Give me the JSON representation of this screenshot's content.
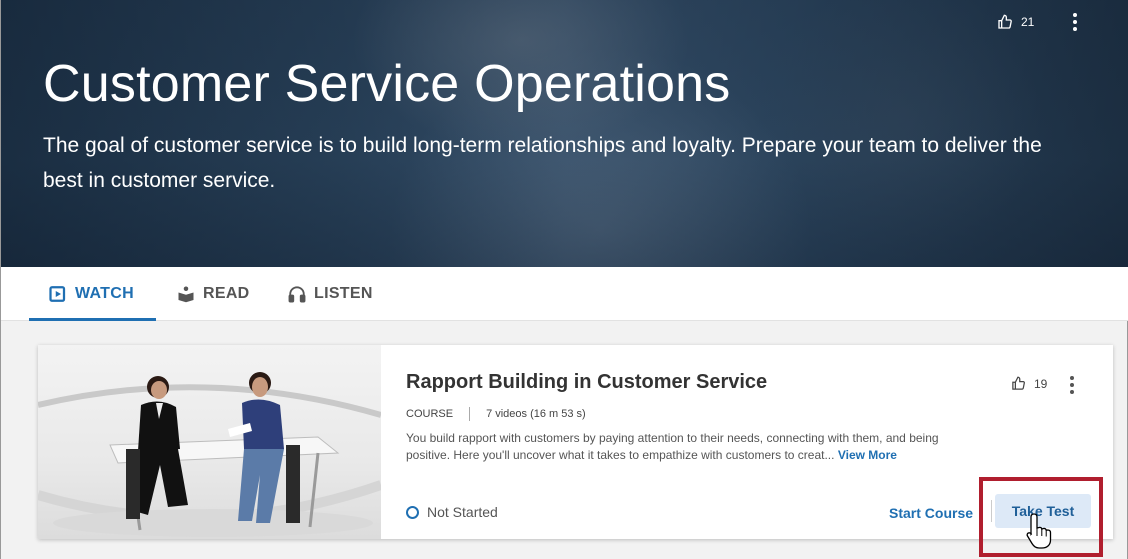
{
  "hero": {
    "title": "Customer Service Operations",
    "description": "The goal of customer service is to build long-term relationships and loyalty. Prepare your team to deliver the best in customer service.",
    "likes": "21",
    "like_icon": "thumbs-up-icon",
    "menu_icon": "more-vertical-icon"
  },
  "tabs": [
    {
      "label": "WATCH",
      "icon": "video-icon",
      "active": true
    },
    {
      "label": "READ",
      "icon": "book-reader-icon",
      "active": false
    },
    {
      "label": "LISTEN",
      "icon": "headphones-icon",
      "active": false
    }
  ],
  "card": {
    "title": "Rapport Building in Customer Service",
    "type": "COURSE",
    "videos": "7 videos (16 m 53 s)",
    "description": "You build rapport with customers by paying attention to their needs, connecting with them, and being positive. Here you'll uncover what it takes to empathize with customers to creat...",
    "view_more": "View More",
    "likes": "19",
    "status": "Not Started",
    "start_label": "Start Course",
    "test_label": "Take Test"
  },
  "colors": {
    "accent": "#1f6fb2",
    "highlight": "#b01e2e"
  }
}
